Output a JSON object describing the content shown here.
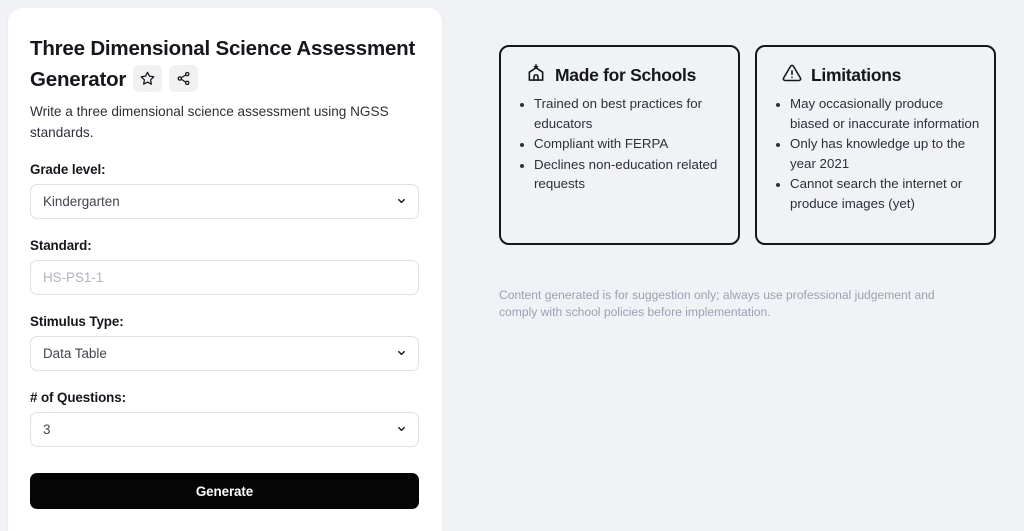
{
  "panel": {
    "title": "Three Dimensional Science Assessment Generator",
    "description": "Write a three dimensional science assessment using NGSS standards.",
    "actions": [
      {
        "name": "favorite",
        "icon": "star-icon",
        "label": "Favorite"
      },
      {
        "name": "share",
        "icon": "share-icon",
        "label": "Share"
      }
    ],
    "fields": [
      {
        "label": "Grade level:",
        "type": "select",
        "value": "Kindergarten",
        "placeholder": "",
        "options": [
          "Kindergarten"
        ]
      },
      {
        "label": "Standard:",
        "type": "text",
        "value": "",
        "placeholder": "HS-PS1-1",
        "options": []
      },
      {
        "label": "Stimulus Type:",
        "type": "select",
        "value": "Data Table",
        "placeholder": "",
        "options": [
          "Data Table"
        ]
      },
      {
        "label": "# of Questions:",
        "type": "select",
        "value": "3",
        "placeholder": "",
        "options": [
          "3"
        ]
      }
    ],
    "submit_label": "Generate"
  },
  "cards": [
    {
      "icon": "school-icon",
      "title": "Made for Schools",
      "items": [
        "Trained on best practices for educators",
        "Compliant with FERPA",
        "Declines non-education related requests"
      ]
    },
    {
      "icon": "warning-triangle-icon",
      "title": "Limitations",
      "items": [
        "May occasionally produce biased or inaccurate information",
        "Only has knowledge up to the year 2021",
        "Cannot search the internet or produce images (yet)"
      ]
    }
  ],
  "disclaimer": "Content generated is for suggestion only; always use professional judgement and comply with school policies before implementation.",
  "colors": {
    "page_background": "#f1f2f6",
    "panel_background": "#ffffff",
    "ink": "#15171c",
    "body_text": "#2c3038",
    "muted_text": "#9aa1ae",
    "placeholder_text": "#adb2bd",
    "border": "#dfe1e6",
    "card_border": "#15171c",
    "button_background": "#050505",
    "button_text": "#ffffff",
    "icon_button_background": "#f1f1f2"
  }
}
